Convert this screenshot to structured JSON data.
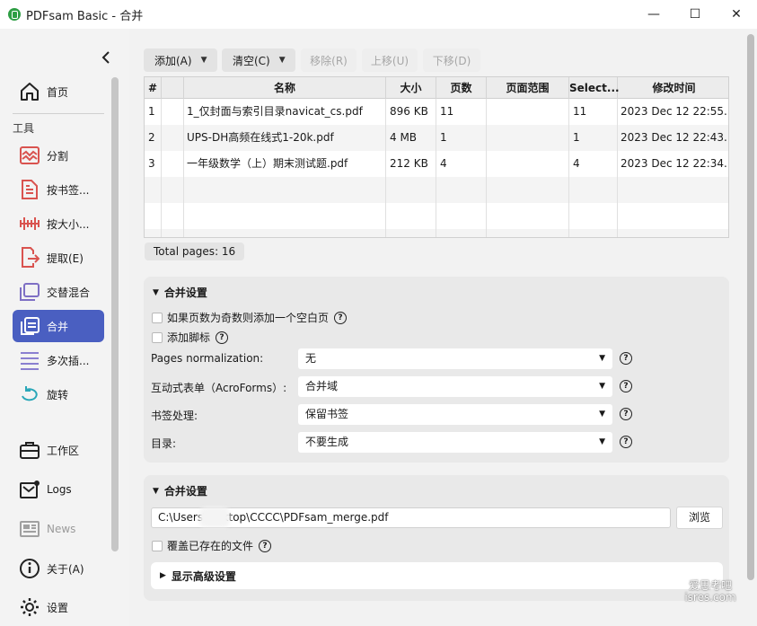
{
  "window": {
    "title": "PDFsam Basic - 合并",
    "min_glyph": "—",
    "max_glyph": "☐",
    "close_glyph": "✕"
  },
  "sidebar": {
    "collapse_glyph": "‹",
    "home": "首页",
    "tools_label": "工具",
    "items": [
      {
        "label": "分割",
        "icon": "split-icon"
      },
      {
        "label": "按书签...",
        "icon": "split-by-bookmarks-icon"
      },
      {
        "label": "按大小...",
        "icon": "split-by-size-icon"
      },
      {
        "label": "提取(E)",
        "icon": "extract-icon"
      },
      {
        "label": "交替混合",
        "icon": "alternate-mix-icon"
      },
      {
        "label": "合并",
        "icon": "merge-icon"
      },
      {
        "label": "多次插...",
        "icon": "multiple-insert-icon"
      },
      {
        "label": "旋转",
        "icon": "rotate-icon"
      }
    ],
    "workspace": "工作区",
    "logs": "Logs",
    "news": "News",
    "about": "关于(A)",
    "settings": "设置"
  },
  "toolbar": {
    "add": "添加(A)",
    "clear": "清空(C)",
    "remove": "移除(R)",
    "move_up": "上移(U)",
    "move_down": "下移(D)"
  },
  "table": {
    "headers": [
      "#",
      "",
      "名称",
      "大小",
      "页数",
      "页面范围",
      "Select...",
      "修改时间"
    ],
    "rows": [
      {
        "num": "1",
        "name": "1_仅封面与索引目录navicat_cs.pdf",
        "size": "896 KB",
        "pages": "11",
        "range": "",
        "selected": "11",
        "modified": "2023 Dec 12 22:55..."
      },
      {
        "num": "2",
        "name": "UPS-DH高频在线式1-20k.pdf",
        "size": "4 MB",
        "pages": "1",
        "range": "",
        "selected": "1",
        "modified": "2023 Dec 12 22:43..."
      },
      {
        "num": "3",
        "name": "一年级数学（上）期末测试题.pdf",
        "size": "212 KB",
        "pages": "4",
        "range": "",
        "selected": "4",
        "modified": "2023 Dec 12 22:34..."
      }
    ]
  },
  "total_pages": "Total pages: 16",
  "merge_settings": {
    "title": "合并设置",
    "blank_page_if_odd": "如果页数为奇数则添加一个空白页",
    "add_footer": "添加脚标",
    "pages_normalization_label": "Pages normalization:",
    "pages_normalization_value": "无",
    "acroforms_label": "互动式表单（AcroForms）:",
    "acroforms_value": "合并域",
    "bookmarks_label": "书签处理:",
    "bookmarks_value": "保留书签",
    "toc_label": "目录:",
    "toc_value": "不要生成"
  },
  "output_settings": {
    "title": "合并设置",
    "path": "C:\\Users\\      esktop\\CCCC\\PDFsam_merge.pdf",
    "browse": "浏览",
    "overwrite": "覆盖已存在的文件",
    "advanced": "显示高级设置"
  },
  "watermark": {
    "line1": "爱思考吧",
    "line2": "isres.com"
  },
  "colors": {
    "accent": "#4a5fc1",
    "panel": "#e9e9e9",
    "sidebar": "#f3f3f3"
  }
}
